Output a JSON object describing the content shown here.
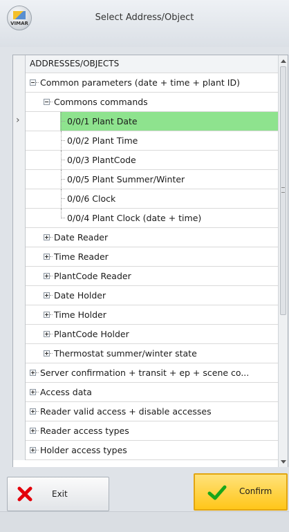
{
  "window": {
    "title": "Select Address/Object",
    "brand": "VIMAR"
  },
  "grid": {
    "column_header": "ADDRESSES/OBJECTS",
    "rows": [
      {
        "label": "Common parameters (date + time + plant ID)",
        "level": 0,
        "toggle": "minus"
      },
      {
        "label": "Commons commands",
        "level": 1,
        "toggle": "minus"
      },
      {
        "label": "0/0/1 Plant Date",
        "level": 2,
        "toggle": "none",
        "selected": true
      },
      {
        "label": "0/0/2 Plant Time",
        "level": 2,
        "toggle": "none"
      },
      {
        "label": "0/0/3 PlantCode",
        "level": 2,
        "toggle": "none"
      },
      {
        "label": "0/0/5 Plant Summer/Winter",
        "level": 2,
        "toggle": "none"
      },
      {
        "label": "0/0/6 Clock",
        "level": 2,
        "toggle": "none"
      },
      {
        "label": "0/0/4 Plant Clock (date + time)",
        "level": 2,
        "toggle": "none"
      },
      {
        "label": "Date Reader",
        "level": 1,
        "toggle": "plus"
      },
      {
        "label": "Time Reader",
        "level": 1,
        "toggle": "plus"
      },
      {
        "label": "PlantCode Reader",
        "level": 1,
        "toggle": "plus"
      },
      {
        "label": "Date Holder",
        "level": 1,
        "toggle": "plus"
      },
      {
        "label": "Time Holder",
        "level": 1,
        "toggle": "plus"
      },
      {
        "label": "PlantCode Holder",
        "level": 1,
        "toggle": "plus"
      },
      {
        "label": "Thermostat summer/winter state",
        "level": 1,
        "toggle": "plus"
      },
      {
        "label": "Server confirmation + transit + ep + scene co...",
        "level": 0,
        "toggle": "plus"
      },
      {
        "label": "Access data",
        "level": 0,
        "toggle": "plus"
      },
      {
        "label": "Reader valid access + disable accesses",
        "level": 0,
        "toggle": "plus"
      },
      {
        "label": "Reader access types",
        "level": 0,
        "toggle": "plus"
      },
      {
        "label": "Holder access types",
        "level": 0,
        "toggle": "plus"
      }
    ]
  },
  "buttons": {
    "exit": "Exit",
    "confirm": "Confirm"
  },
  "colors": {
    "selection": "#8ee38e",
    "confirm_bg": "#ffc619",
    "exit_icon": "#e3000b",
    "confirm_icon": "#1aa61a"
  }
}
